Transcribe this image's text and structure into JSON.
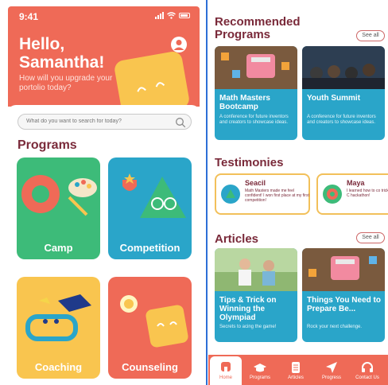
{
  "left": {
    "status_time": "9:41",
    "greeting_line1": "Hello,",
    "greeting_line2": "Samantha!",
    "subtitle": "How will you upgrade your portolio today?",
    "search_placeholder": "What do you want to search for today?",
    "programs_heading": "Programs",
    "cards": [
      {
        "label": "Camp",
        "color": "#3dbb79"
      },
      {
        "label": "Competition",
        "color": "#2aa5c9"
      },
      {
        "label": "Coaching",
        "color": "#f9c54f"
      },
      {
        "label": "Counseling",
        "color": "#ef6a57"
      }
    ]
  },
  "right": {
    "recommended_heading_1": "Recommended",
    "recommended_heading_2": "Programs",
    "see_all": "See all",
    "programs": [
      {
        "title": "Math Masters Bootcamp",
        "desc": "A conference for future inventors and creators to showcase ideas."
      },
      {
        "title": "Youth Summit",
        "desc": "A conference for future inventors and creators to showcase ideas."
      }
    ],
    "testimonies_heading": "Testimonies",
    "testimonies": [
      {
        "name": "Seacil",
        "text": "Math Masters made me feel confident! I won first place at my first competition!"
      },
      {
        "name": "Maya",
        "text": "I learned how to co tricky problems. C hackathon!"
      }
    ],
    "articles_heading": "Articles",
    "articles": [
      {
        "title": "Tips & Trick on Winning the Olympiad",
        "desc": "Secrets to acing the game!"
      },
      {
        "title": "Things You Need to Prepare Be...",
        "desc": "Rock your next challenge."
      }
    ],
    "nav": [
      {
        "label": "Home",
        "icon": "home-icon"
      },
      {
        "label": "Programs",
        "icon": "graduation-cap-icon"
      },
      {
        "label": "Articles",
        "icon": "document-icon"
      },
      {
        "label": "Progress",
        "icon": "send-icon"
      },
      {
        "label": "Contact Us",
        "icon": "headset-icon"
      }
    ]
  },
  "colors": {
    "primary": "#ef6a57",
    "heading": "#7a2a3a",
    "green": "#3dbb79",
    "blue": "#2aa5c9",
    "yellow": "#f9c54f",
    "divider": "#2d6fd6"
  }
}
